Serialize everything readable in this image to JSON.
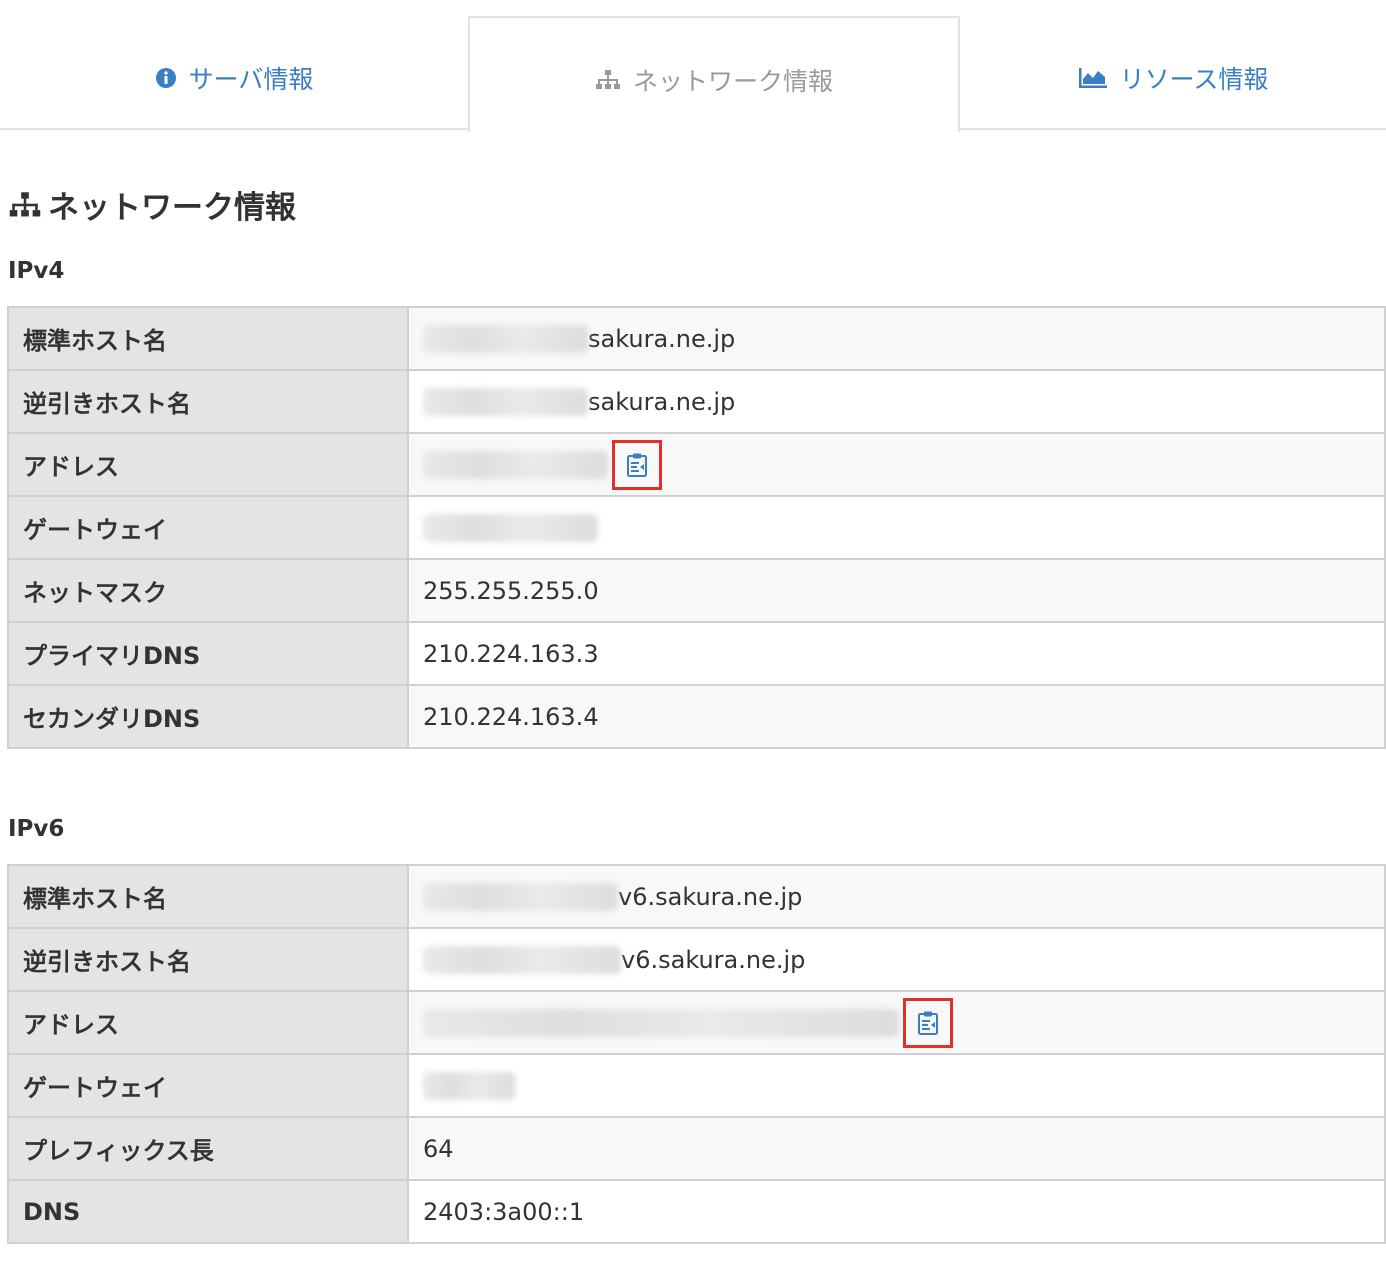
{
  "tabs": [
    {
      "label": "サーバ情報",
      "icon": "info-circle-icon"
    },
    {
      "label": "ネットワーク情報",
      "icon": "network-icon",
      "active": true
    },
    {
      "label": "リソース情報",
      "icon": "area-chart-icon"
    }
  ],
  "page_title": "ネットワーク情報",
  "ipv4": {
    "title": "IPv4",
    "rows": [
      {
        "label": "標準ホスト名",
        "value": "sakura.ne.jp"
      },
      {
        "label": "逆引きホスト名",
        "value": "sakura.ne.jp"
      },
      {
        "label": "アドレス",
        "value": ""
      },
      {
        "label": "ゲートウェイ",
        "value": ""
      },
      {
        "label": "ネットマスク",
        "value": "255.255.255.0"
      },
      {
        "label": "プライマリDNS",
        "value": "210.224.163.3"
      },
      {
        "label": "セカンダリDNS",
        "value": "210.224.163.4"
      }
    ]
  },
  "ipv6": {
    "title": "IPv6",
    "rows": [
      {
        "label": "標準ホスト名",
        "value": "v6.sakura.ne.jp"
      },
      {
        "label": "逆引きホスト名",
        "value": "v6.sakura.ne.jp"
      },
      {
        "label": "アドレス",
        "value": ""
      },
      {
        "label": "ゲートウェイ",
        "value": ""
      },
      {
        "label": "プレフィックス長",
        "value": "64"
      },
      {
        "label": "DNS",
        "value": "2403:3a00::1"
      }
    ]
  },
  "colors": {
    "link": "#3a7fc4",
    "highlight": "#e0302a",
    "label_bg": "#e4e4e4"
  }
}
